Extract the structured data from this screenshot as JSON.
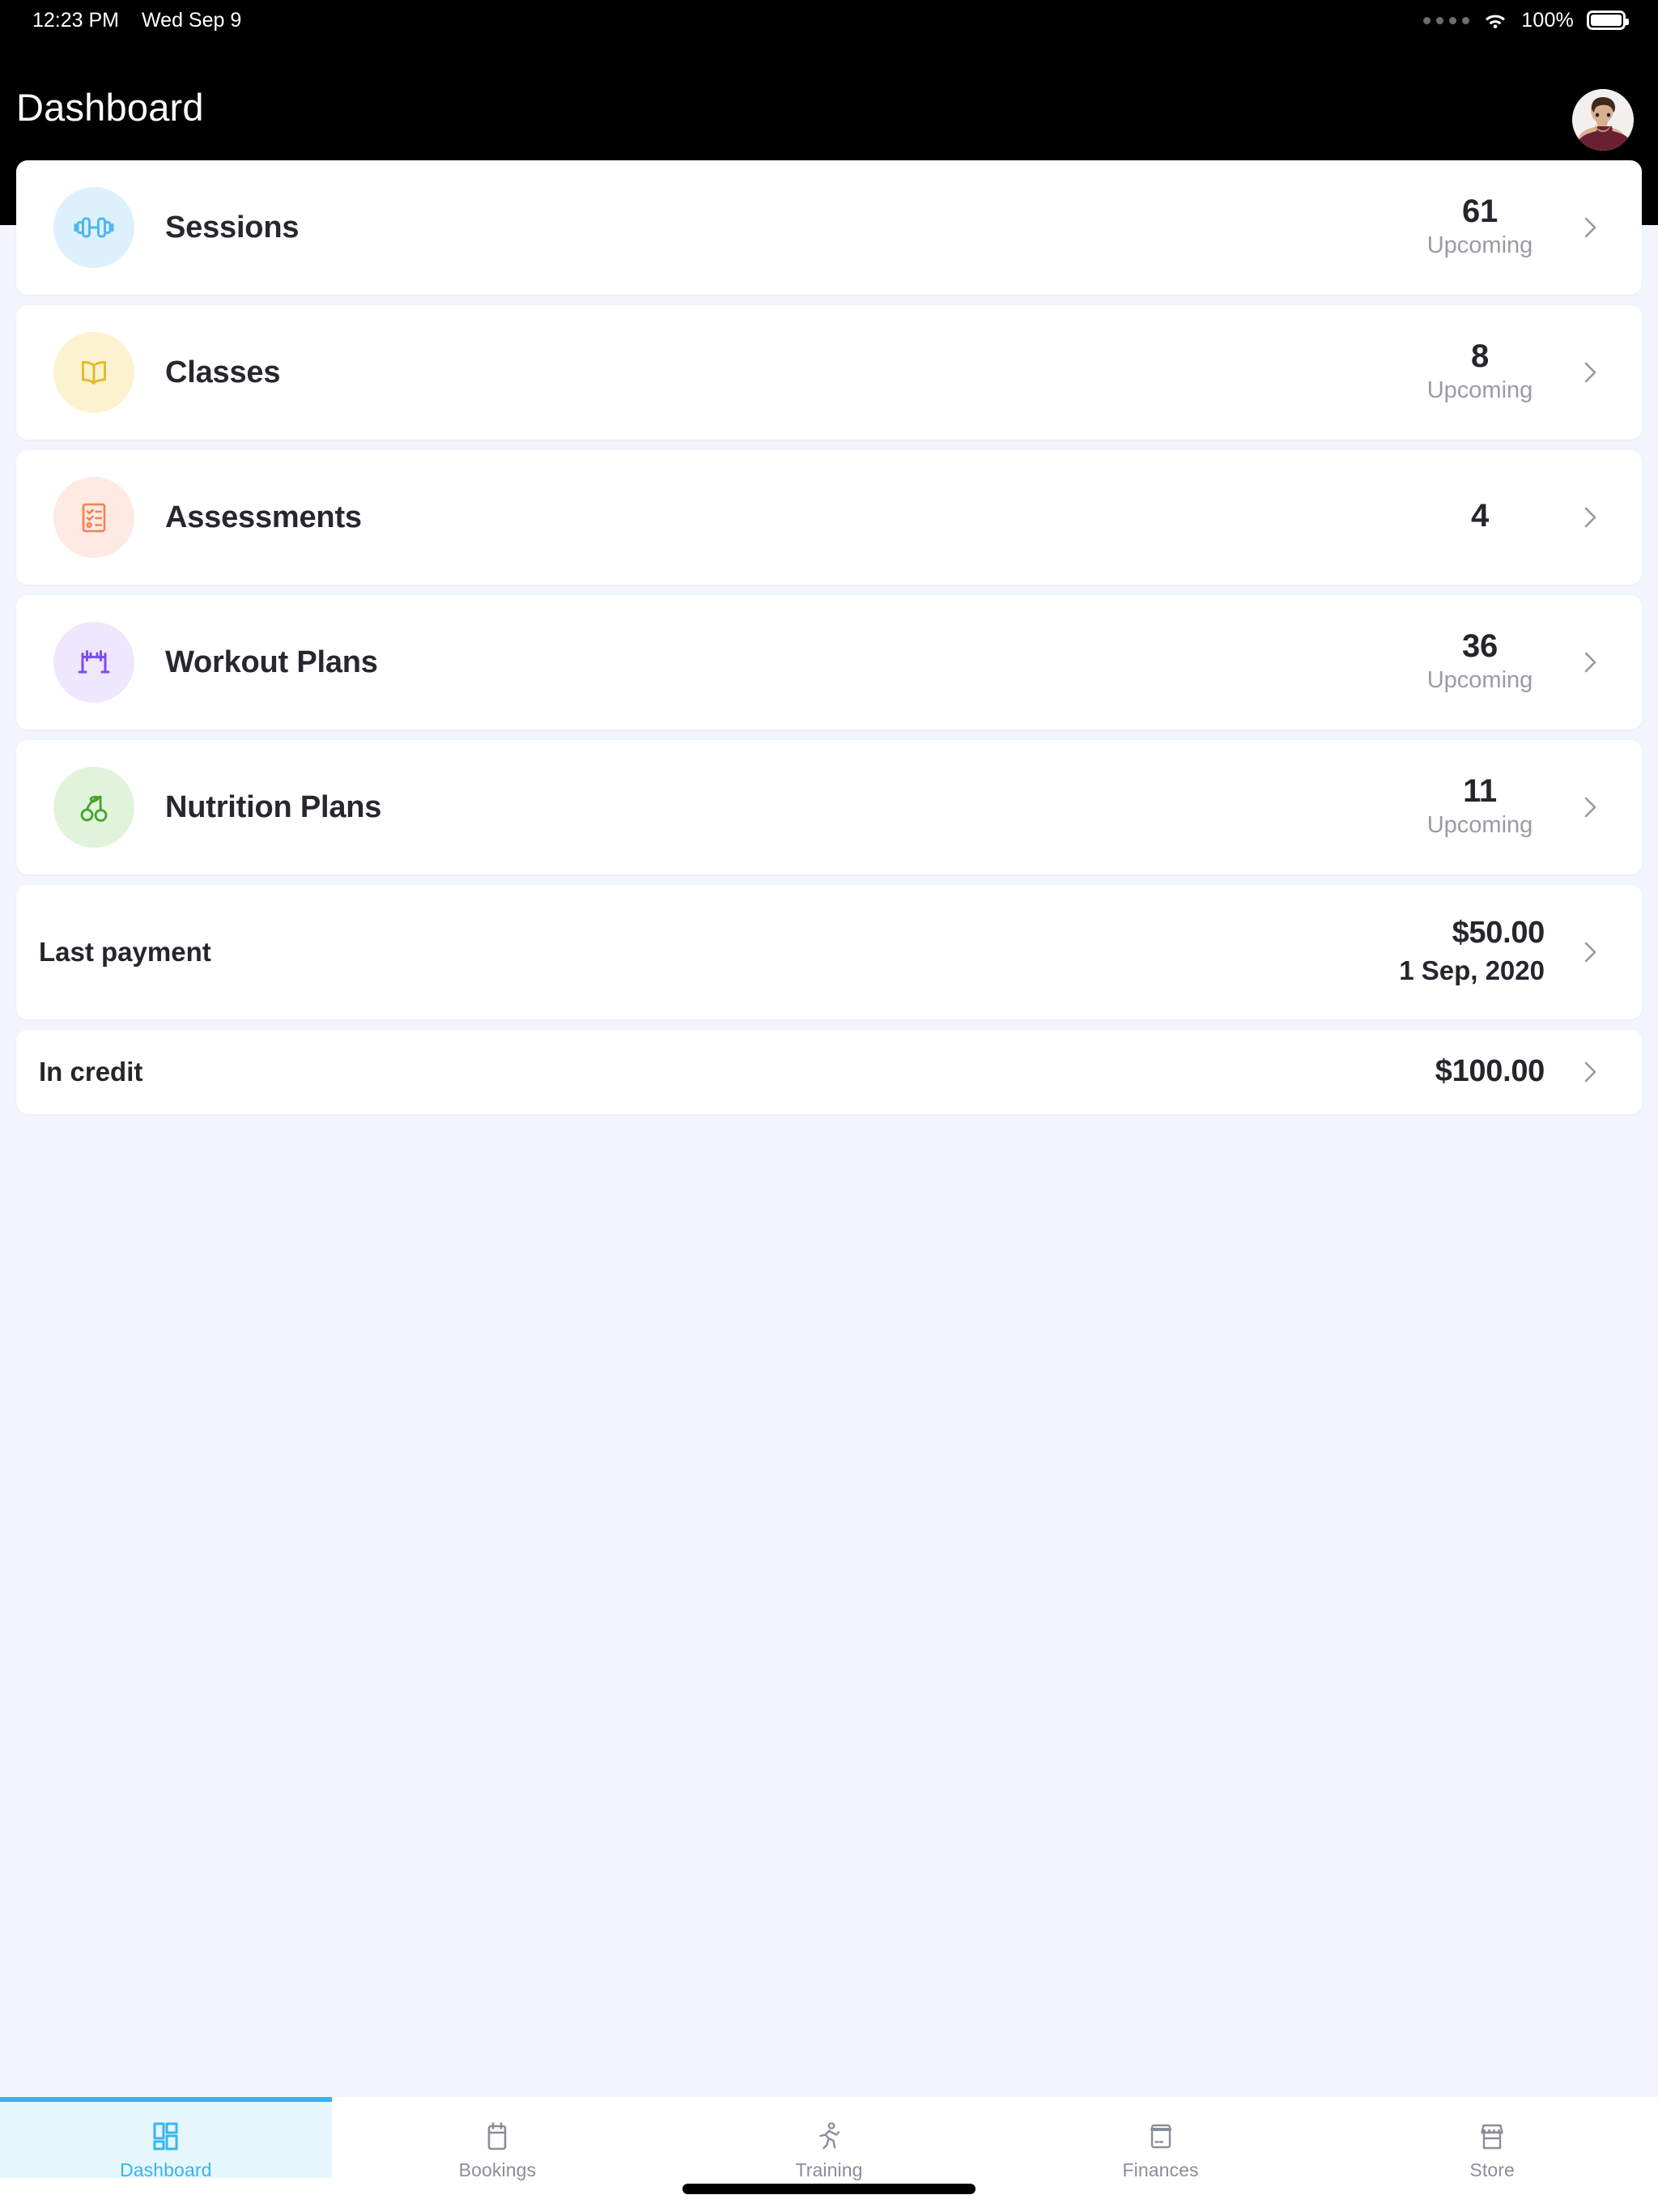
{
  "statusbar": {
    "time": "12:23 PM",
    "date": "Wed Sep 9",
    "battery_percent": "100%",
    "signal_icon": "signal-dots-icon",
    "wifi_icon": "wifi-icon",
    "battery_icon": "battery-full-icon"
  },
  "navbar": {
    "title": "Dashboard",
    "avatar_icon": "user-avatar-photo"
  },
  "rows": [
    {
      "key": "sessions",
      "label": "Sessions",
      "value": "61",
      "sub": "Upcoming",
      "icon": "dumbbell-icon",
      "icon_color": "#4cb8f0",
      "circle_color": "#ddf1fc"
    },
    {
      "key": "classes",
      "label": "Classes",
      "value": "8",
      "sub": "Upcoming",
      "icon": "open-book-icon",
      "icon_color": "#e3bb2e",
      "circle_color": "#fcf2cf"
    },
    {
      "key": "assessments",
      "label": "Assessments",
      "value": "4",
      "sub": "",
      "icon": "checklist-clipboard-icon",
      "icon_color": "#f4814f",
      "circle_color": "#fdeae3"
    },
    {
      "key": "workout-plans",
      "label": "Workout Plans",
      "value": "36",
      "sub": "Upcoming",
      "icon": "barbell-rack-icon",
      "icon_color": "#7c4dec",
      "circle_color": "#eee7fd"
    },
    {
      "key": "nutrition-plans",
      "label": "Nutrition Plans",
      "value": "11",
      "sub": "Upcoming",
      "icon": "cherries-icon",
      "icon_color": "#45a52a",
      "circle_color": "#e2f3dc"
    }
  ],
  "finance": {
    "last_payment": {
      "label": "Last payment",
      "amount": "$50.00",
      "date": "1 Sep, 2020"
    },
    "in_credit": {
      "label": "In credit",
      "amount": "$100.00"
    }
  },
  "tabs": [
    {
      "key": "dashboard",
      "label": "Dashboard",
      "icon": "dashboard-grid-icon",
      "active": true
    },
    {
      "key": "bookings",
      "label": "Bookings",
      "icon": "calendar-icon",
      "active": false
    },
    {
      "key": "training",
      "label": "Training",
      "icon": "running-person-icon",
      "active": false
    },
    {
      "key": "finances",
      "label": "Finances",
      "icon": "credit-card-icon",
      "active": false
    },
    {
      "key": "store",
      "label": "Store",
      "icon": "storefront-icon",
      "active": false
    }
  ],
  "colors": {
    "accent": "#34b5ec",
    "active_tab_bg": "#e6f6fd",
    "page_bg": "#f2f5fd",
    "navbar_bg": "#000000",
    "card_bg": "#ffffff",
    "muted_text": "#9b9ba3"
  }
}
